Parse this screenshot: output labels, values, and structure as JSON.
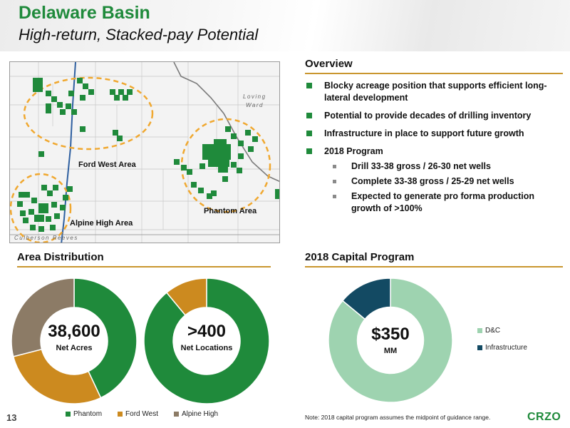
{
  "header": {
    "title": "Delaware Basin",
    "subtitle": "High-return, Stacked-pay Potential"
  },
  "map": {
    "labels": {
      "ford_west": "Ford West Area",
      "alpine_high": "Alpine High Area",
      "phantom": "Phantom Area"
    },
    "counties": {
      "loving": "Loving",
      "ward": "Ward",
      "culberson_reeves": "Culberson Reeves"
    },
    "colors": {
      "acreage": "#1f8a3b",
      "outline": "#f0a830",
      "background": "#f3f3f3"
    }
  },
  "overview": {
    "heading": "Overview",
    "bullets": [
      "Blocky acreage position that supports efficient long-lateral development",
      "Potential to provide decades of drilling inventory",
      "Infrastructure in place to support future growth",
      "2018 Program"
    ],
    "sub_bullets": [
      "Drill 33-38 gross / 26-30 net wells",
      "Complete 33-38 gross / 25-29 net wells",
      "Expected to generate pro forma production growth of >100%"
    ]
  },
  "area_distribution": {
    "heading": "Area Distribution",
    "acres_value": "38,600",
    "acres_label": "Net Acres",
    "locations_value": ">400",
    "locations_label": "Net Locations"
  },
  "capital_program": {
    "heading": "2018 Capital Program",
    "value": "$350",
    "unit": "MM"
  },
  "chart_data": [
    {
      "type": "pie",
      "categories": [
        "Phantom",
        "Ford West",
        "Alpine High"
      ],
      "values": [
        43,
        28,
        29
      ],
      "colors": [
        "#1f8a3b",
        "#cc8a1f",
        "#8c7b66"
      ]
    },
    {
      "type": "pie",
      "categories": [
        "Phantom",
        "Ford West"
      ],
      "values": [
        89,
        11
      ],
      "colors": [
        "#1f8a3b",
        "#cc8a1f"
      ]
    },
    {
      "type": "pie",
      "categories": [
        "D&C",
        "Infrastructure"
      ],
      "values": [
        86,
        14
      ],
      "colors": [
        "#9ed3b0",
        "#134a63"
      ]
    }
  ],
  "legend": {
    "area": [
      "Phantom",
      "Ford West",
      "Alpine High"
    ],
    "capital": [
      "D&C",
      "Infrastructure"
    ]
  },
  "footer": {
    "page_number": "13",
    "note": "Note: 2018 capital program assumes the midpoint of guidance range.",
    "logo": "CRZO"
  }
}
